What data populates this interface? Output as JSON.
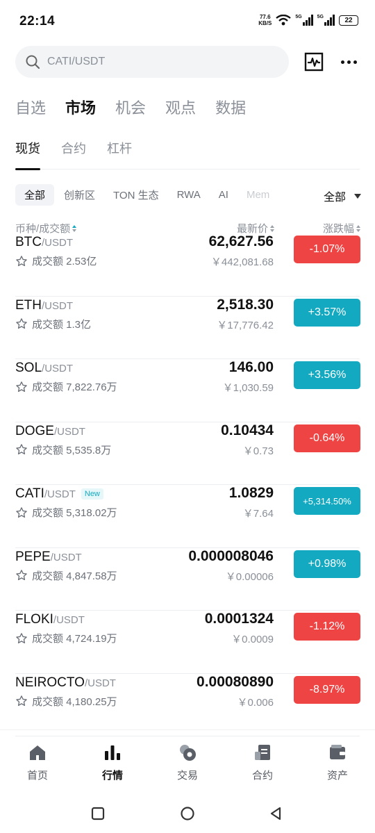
{
  "status": {
    "time": "22:14",
    "net_speed_value": "77.6",
    "net_speed_unit": "KB/S",
    "sim1": "5G",
    "sim2": "5G",
    "battery": "22"
  },
  "search": {
    "text": "CATI/USDT"
  },
  "main_tabs": [
    {
      "label": "自选",
      "active": false
    },
    {
      "label": "市场",
      "active": true
    },
    {
      "label": "机会",
      "active": false
    },
    {
      "label": "观点",
      "active": false
    },
    {
      "label": "数据",
      "active": false
    }
  ],
  "sub_tabs": [
    {
      "label": "现货",
      "active": true
    },
    {
      "label": "合约",
      "active": false
    },
    {
      "label": "杠杆",
      "active": false
    }
  ],
  "chips": [
    "全部",
    "创新区",
    "TON 生态",
    "RWA",
    "AI",
    "Mem"
  ],
  "filter_select": "全部",
  "columns": {
    "pair": "币种/成交额",
    "price": "最新价",
    "change": "涨跌幅"
  },
  "colors": {
    "up": "#12a9c1",
    "down": "#ef4444"
  },
  "rows": [
    {
      "base": "BTC",
      "quote": "/USDT",
      "badge": "",
      "volume": "成交额 2.53亿",
      "price": "62,627.56",
      "fiat": "￥442,081.68",
      "change": "-1.07%",
      "dir": "down"
    },
    {
      "base": "ETH",
      "quote": "/USDT",
      "badge": "",
      "volume": "成交额 1.3亿",
      "price": "2,518.30",
      "fiat": "￥17,776.42",
      "change": "+3.57%",
      "dir": "up"
    },
    {
      "base": "SOL",
      "quote": "/USDT",
      "badge": "",
      "volume": "成交额 7,822.76万",
      "price": "146.00",
      "fiat": "￥1,030.59",
      "change": "+3.56%",
      "dir": "up"
    },
    {
      "base": "DOGE",
      "quote": "/USDT",
      "badge": "",
      "volume": "成交额 5,535.8万",
      "price": "0.10434",
      "fiat": "￥0.73",
      "change": "-0.64%",
      "dir": "down"
    },
    {
      "base": "CATI",
      "quote": "/USDT",
      "badge": "New",
      "volume": "成交额 5,318.02万",
      "price": "1.0829",
      "fiat": "￥7.64",
      "change": "+5,314.50%",
      "dir": "up"
    },
    {
      "base": "PEPE",
      "quote": "/USDT",
      "badge": "",
      "volume": "成交额 4,847.58万",
      "price": "0.000008046",
      "fiat": "￥0.00006",
      "change": "+0.98%",
      "dir": "up"
    },
    {
      "base": "FLOKI",
      "quote": "/USDT",
      "badge": "",
      "volume": "成交额 4,724.19万",
      "price": "0.0001324",
      "fiat": "￥0.0009",
      "change": "-1.12%",
      "dir": "down"
    },
    {
      "base": "NEIROCTO",
      "quote": "/USDT",
      "badge": "",
      "volume": "成交额 4,180.25万",
      "price": "0.00080890",
      "fiat": "￥0.006",
      "change": "-8.97%",
      "dir": "down"
    }
  ],
  "bottom_nav": [
    {
      "label": "首页",
      "icon": "home-icon",
      "active": false
    },
    {
      "label": "行情",
      "icon": "market-bars-icon",
      "active": true
    },
    {
      "label": "交易",
      "icon": "trade-coins-icon",
      "active": false
    },
    {
      "label": "合约",
      "icon": "contract-doc-icon",
      "active": false
    },
    {
      "label": "资产",
      "icon": "wallet-icon",
      "active": false
    }
  ]
}
